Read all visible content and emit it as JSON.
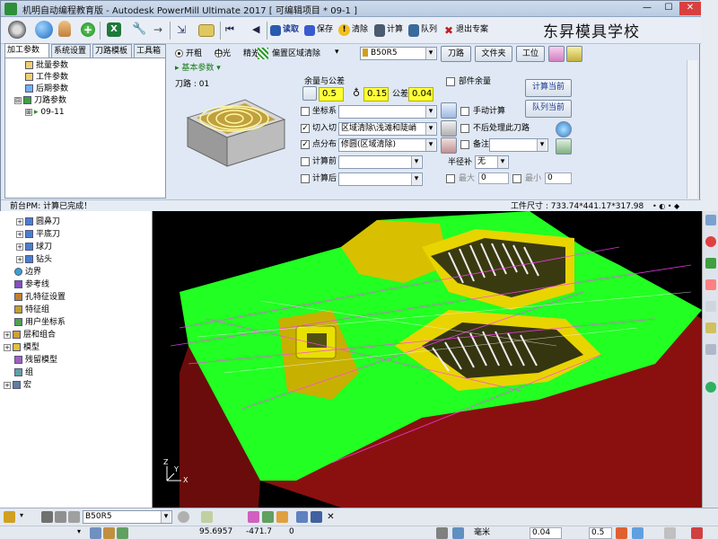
{
  "window": {
    "title": "机明自动编程教育版 - Autodesk PowerMill Ultimate 2017  [ 可编辑项目 * 09-1 ]",
    "controls": [
      "—",
      "☐",
      "✕"
    ]
  },
  "toolbar": {
    "read_label": "读取",
    "save_label": "保存",
    "clear_label": "清除",
    "calc_label": "计算",
    "queue_label": "队列",
    "exit_label": "退出专案"
  },
  "watermark": "东昇模具学校",
  "tabs": [
    "加工参数",
    "系统设置",
    "刀路模板",
    "工具箱"
  ],
  "dialog_tree": [
    {
      "label": "批量参数"
    },
    {
      "label": "工件参数"
    },
    {
      "label": "后期参数"
    },
    {
      "label": "刀路参数",
      "expander": "⊟"
    },
    {
      "label": "09-11",
      "expander": "⊞"
    }
  ],
  "rough_options": {
    "open_label": "开粗",
    "medium_label": "中光",
    "finish_label": "精光",
    "strategy_value": "偏置区域清除",
    "tool_value": "B50R5",
    "toolpath_btn": "刀路",
    "folder_btn": "文件夹",
    "workpos_btn": "工位"
  },
  "section_title": "基本参数",
  "toolpath_label": "刀路 : 01",
  "allowance": {
    "title": "余量与公差",
    "side": "0.5",
    "bottom": "0.15",
    "tol_label": "公差",
    "tol": "0.04",
    "part_allowance_label": "部件余量"
  },
  "rows": {
    "coord_label": "坐标系",
    "cutin_label": "切入切",
    "cutin_value": "区域清除\\浅滩和陡峭",
    "distrib_label": "点分布",
    "distrib_value": "修圆(区域清除)",
    "calc_before_label": "计算前",
    "calc_after_label": "计算后"
  },
  "right_options": {
    "manual_calc": "手动计算",
    "no_post": "不后处理此刀路",
    "note": "备注",
    "radius_comp": "半径补",
    "radius_comp_value": "无",
    "min_label": "最大",
    "min_value": "0",
    "max_label": "最小",
    "max_value": "0"
  },
  "calc_buttons": {
    "calc_current": "计算当前",
    "queue_current": "队列当前"
  },
  "status": {
    "message": "前台PM: 计算已完成！",
    "workpiece": "工件尺寸 :  733.74*441.17*317.98"
  },
  "explorer_tree": [
    {
      "label": "圆鼻刀",
      "indent": 2,
      "color": "#4a7fd0"
    },
    {
      "label": "平底刀",
      "indent": 2,
      "color": "#4a7fd0"
    },
    {
      "label": "球刀",
      "indent": 2,
      "color": "#4a7fd0"
    },
    {
      "label": "钻头",
      "indent": 2,
      "color": "#4a7fd0"
    },
    {
      "label": "边界",
      "indent": 1,
      "color": "#3aa0d0"
    },
    {
      "label": "参考线",
      "indent": 1,
      "color": "#8050c0"
    },
    {
      "label": "孔特征设置",
      "indent": 1,
      "color": "#c08030"
    },
    {
      "label": "特征组",
      "indent": 1,
      "color": "#c0a030"
    },
    {
      "label": "用户坐标系",
      "indent": 1,
      "color": "#50a050"
    },
    {
      "label": "层和组合",
      "indent": 0,
      "color": "#d0a030"
    },
    {
      "label": "模型",
      "indent": 0,
      "color": "#e0c040"
    },
    {
      "label": "残留模型",
      "indent": 1,
      "color": "#a060c0"
    },
    {
      "label": "组",
      "indent": 1,
      "color": "#60a0a0"
    },
    {
      "label": "宏",
      "indent": 0,
      "color": "#6080a0"
    }
  ],
  "bottom_bar": {
    "tool_combo": "B50R5",
    "x_value": "95.6957",
    "y_value": "-471.7",
    "z_value": "0",
    "unit_label": "毫米",
    "step1": "0.04",
    "step2": "0.5"
  },
  "colors": {
    "green_surface": "#22ff22",
    "wall_red": "#8a1010",
    "yellow": "#f2e000",
    "magenta": "#ff40ff"
  }
}
